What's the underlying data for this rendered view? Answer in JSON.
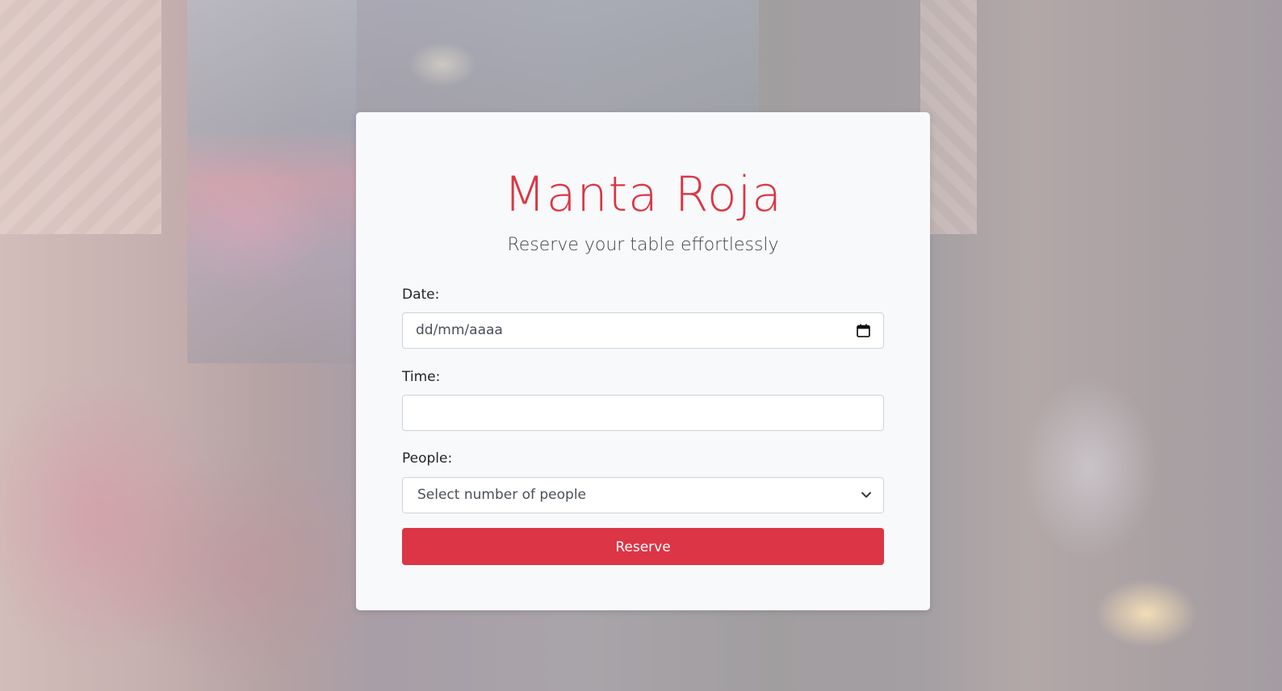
{
  "colors": {
    "brand": "#dc3545",
    "card_background": "#f8f9fa",
    "button_text": "#ffffff"
  },
  "header": {
    "title": "Manta Roja",
    "subtitle": "Reserve your table effortlessly"
  },
  "form": {
    "date": {
      "label": "Date:",
      "value": "dd/mm/aaaa",
      "icon": "calendar-icon"
    },
    "time": {
      "label": "Time:",
      "value": ""
    },
    "people": {
      "label": "People:",
      "selected": "Select number of people",
      "icon": "chevron-down-icon"
    },
    "submit_label": "Reserve"
  }
}
